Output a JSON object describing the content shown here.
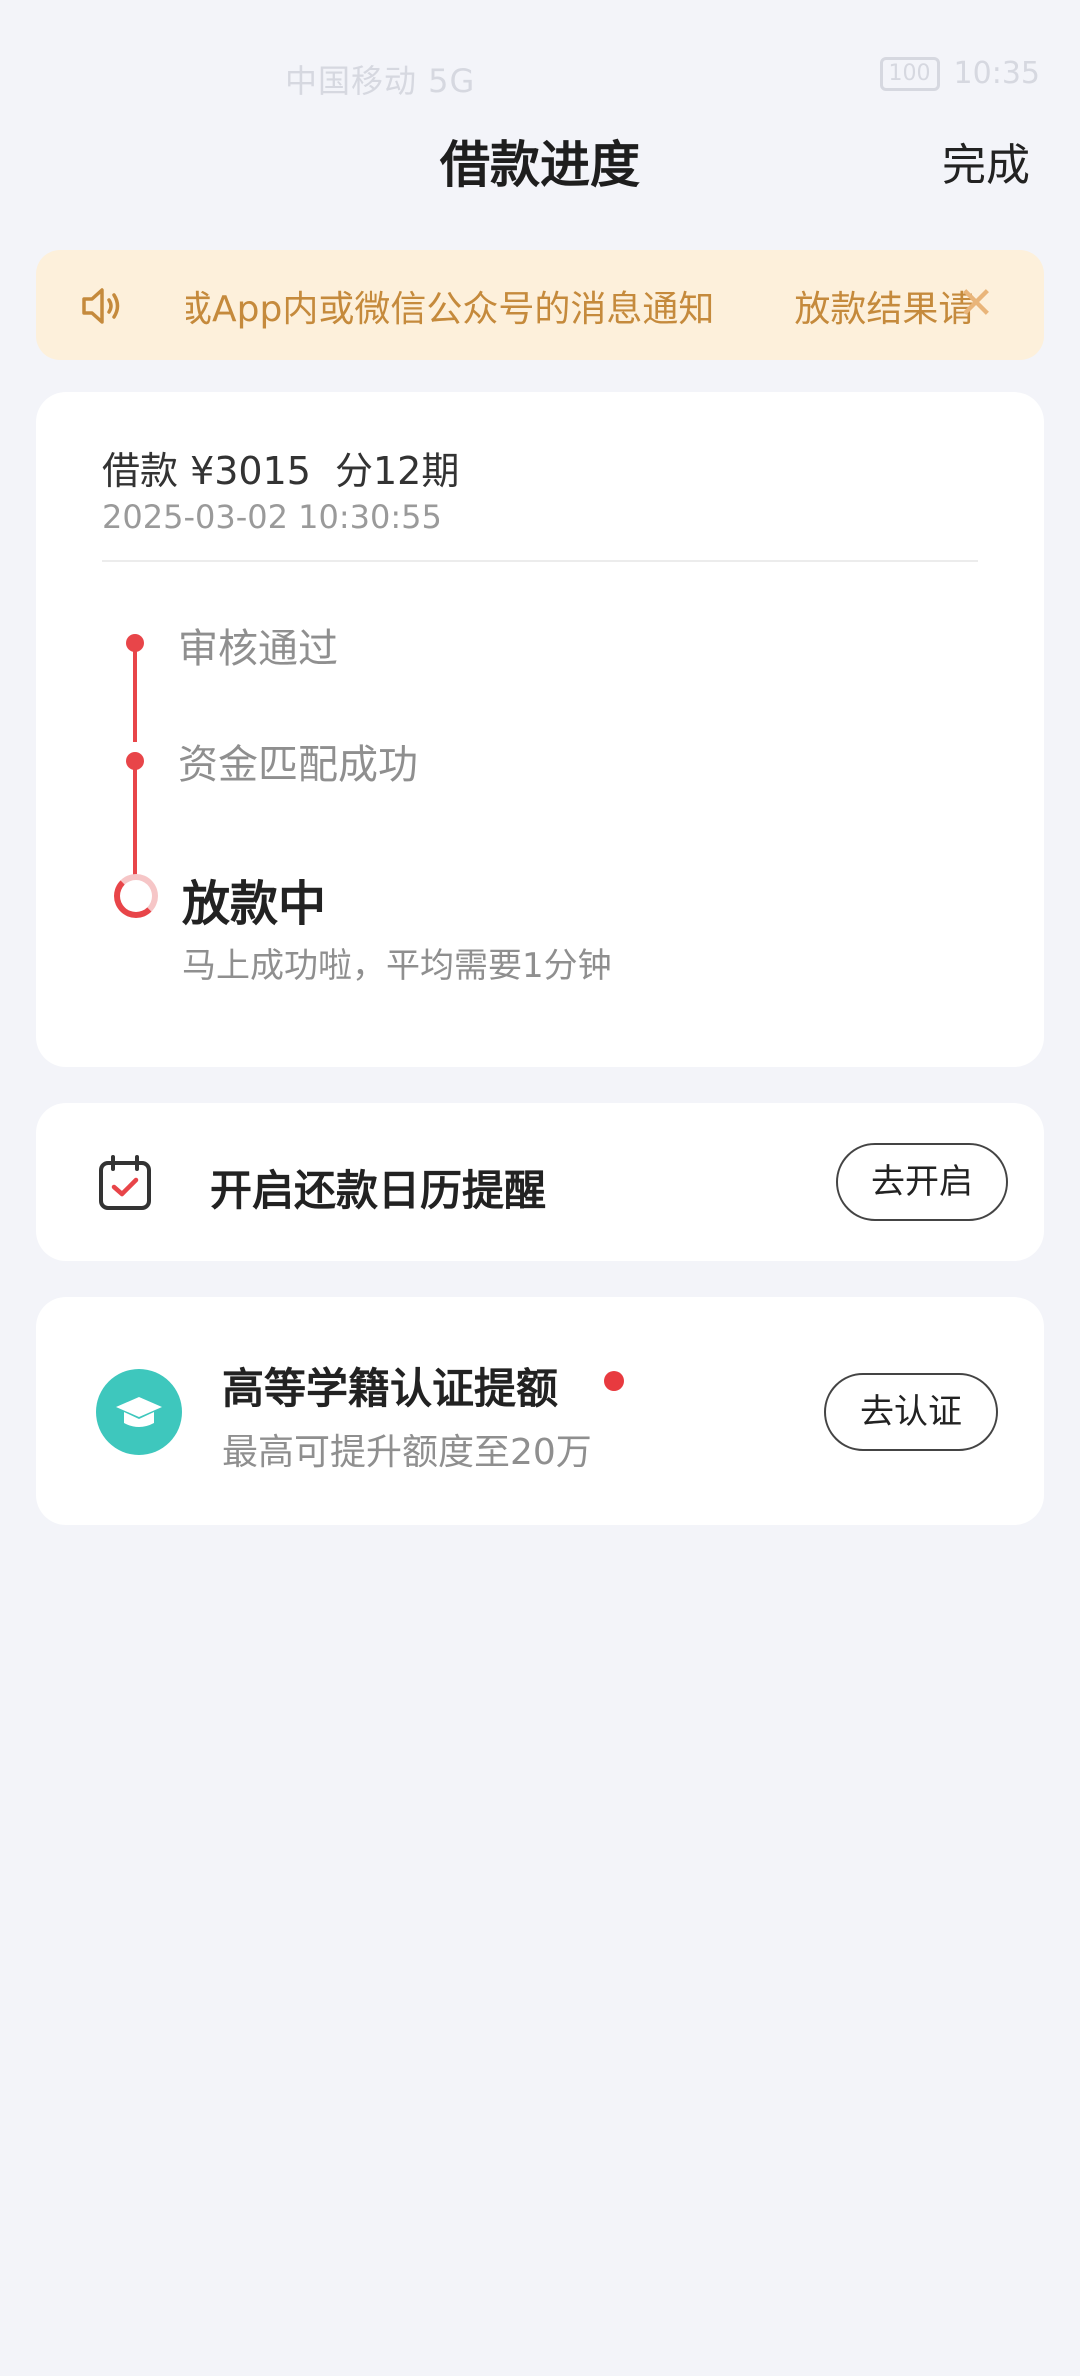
{
  "status_bar": {
    "carrier": "中国移动 5G",
    "battery": "100",
    "time": "10:35"
  },
  "header": {
    "title": "借款进度",
    "done_label": "完成"
  },
  "notice": {
    "text_1": "或App内或微信公众号的消息通知",
    "text_2": "放款结果请留",
    "icon": "speaker-icon",
    "close_icon": "close-icon",
    "text_color": "#c58a3c",
    "background": "#fdf0db"
  },
  "loan": {
    "amount": "借款 ¥3015",
    "term": "分12期",
    "time": "2025-03-02 10:30:55",
    "steps": [
      {
        "label": "审核通过",
        "state": "done"
      },
      {
        "label": "资金匹配成功",
        "state": "done"
      },
      {
        "label": "放款中",
        "state": "active",
        "sub": "马上成功啦，平均需要1分钟"
      }
    ],
    "accent_color": "#e84549"
  },
  "calendar": {
    "label": "开启还款日历提醒",
    "button": "去开启",
    "icon": "calendar-check-icon"
  },
  "education": {
    "title": "高等学籍认证提额",
    "subtitle": "最高可提升额度至20万",
    "button": "去认证",
    "icon": "graduation-cap-icon",
    "icon_color": "#3ec7bd"
  }
}
